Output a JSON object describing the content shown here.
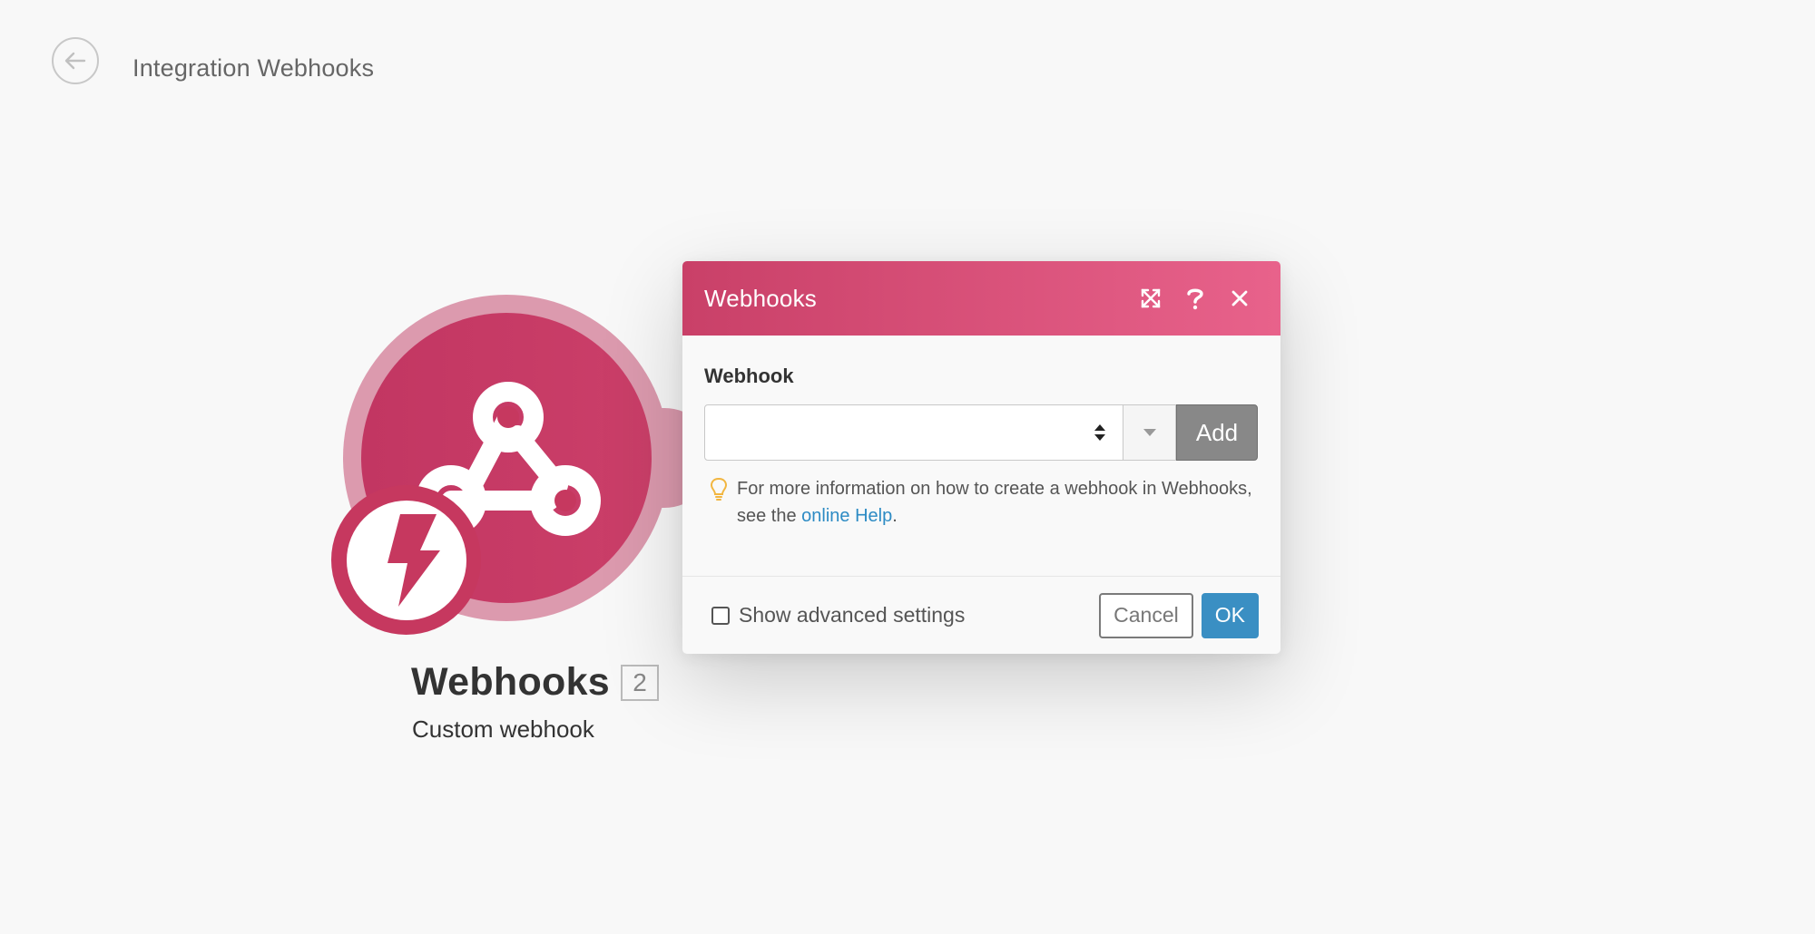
{
  "header": {
    "back_icon": "arrow-left-circle-icon",
    "title": "Integration Webhooks"
  },
  "module": {
    "name": "Webhooks",
    "count": "2",
    "subtitle": "Custom webhook",
    "icon": "webhook-icon",
    "trigger_icon": "lightning-bolt-icon",
    "colors": {
      "primary": "#c6385f",
      "ring": "#dc9aae"
    }
  },
  "dialog": {
    "title": "Webhooks",
    "header_icons": [
      "expand-icon",
      "help-icon",
      "close-icon"
    ],
    "field_label": "Webhook",
    "select_value": "",
    "add_label": "Add",
    "help_text_before": "For more information on how to create a webhook in Webhooks, see the ",
    "help_link": "online Help",
    "help_text_after": ".",
    "advanced_label": "Show advanced settings",
    "cancel_label": "Cancel",
    "ok_label": "OK",
    "colors": {
      "header_start": "#c94068",
      "header_end": "#e8628b",
      "ok": "#3a8fc3",
      "link": "#2d8bc4"
    }
  }
}
